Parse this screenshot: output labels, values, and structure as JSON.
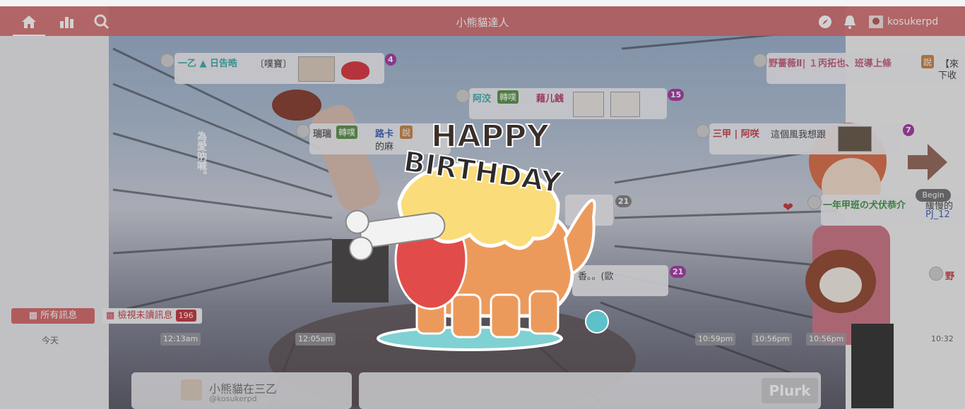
{
  "nav": {
    "title": "小熊貓達人",
    "username": "kosukerpd"
  },
  "overlay_text": "為愛吶喊。",
  "sticker": {
    "line1": "HAPPY",
    "line2": "BIRTHDAY"
  },
  "plurks": [
    {
      "name": "一乙 ▲ 日告晧",
      "text": "〔噗寶〕",
      "count": "4"
    },
    {
      "name": "阿洨",
      "qualifier": "轉噗",
      "name2": "藉儿銭",
      "count": "15"
    },
    {
      "name": "瑞瑞",
      "qualifier": "轉噗",
      "name2": "路卡",
      "qualifier2": "說",
      "text": "的麻",
      "count": ""
    },
    {
      "name": "三甲 | 阿咲",
      "text": "這個風我想跟",
      "count": "7"
    },
    {
      "name": "野薔薇Ⅱ| １丙拓也、班導上條",
      "qualifier": "說",
      "text": "【來",
      "text2": "下收",
      "count": ""
    },
    {
      "name": "一年甲班の犬伏恭介",
      "text": "緩慢的",
      "text2": "PJ_12",
      "count": ""
    },
    {
      "name": "",
      "text": "香。。(歐",
      "count": "21"
    },
    {
      "name": "",
      "text": "",
      "count": "21"
    },
    {
      "name": "野",
      "text": "",
      "count": ""
    }
  ],
  "begin_label": "Begin",
  "filters": {
    "all": "所有訊息",
    "unread": "檢視未讀訊息",
    "unread_count": "196"
  },
  "today": "今天",
  "times": [
    "12:13am",
    "12:05am",
    "10:59pm",
    "10:56pm",
    "10:56pm",
    "10:32"
  ],
  "composer": {
    "name": "小熊貓在三乙",
    "handle": "@kosukerpd",
    "button": "Plurk"
  },
  "colors": {
    "navbar": "#d15e5e",
    "counter": "#9d2a9b",
    "qualifier_repost": "#4c8a3a",
    "qualifier_says": "#c47a3a"
  }
}
